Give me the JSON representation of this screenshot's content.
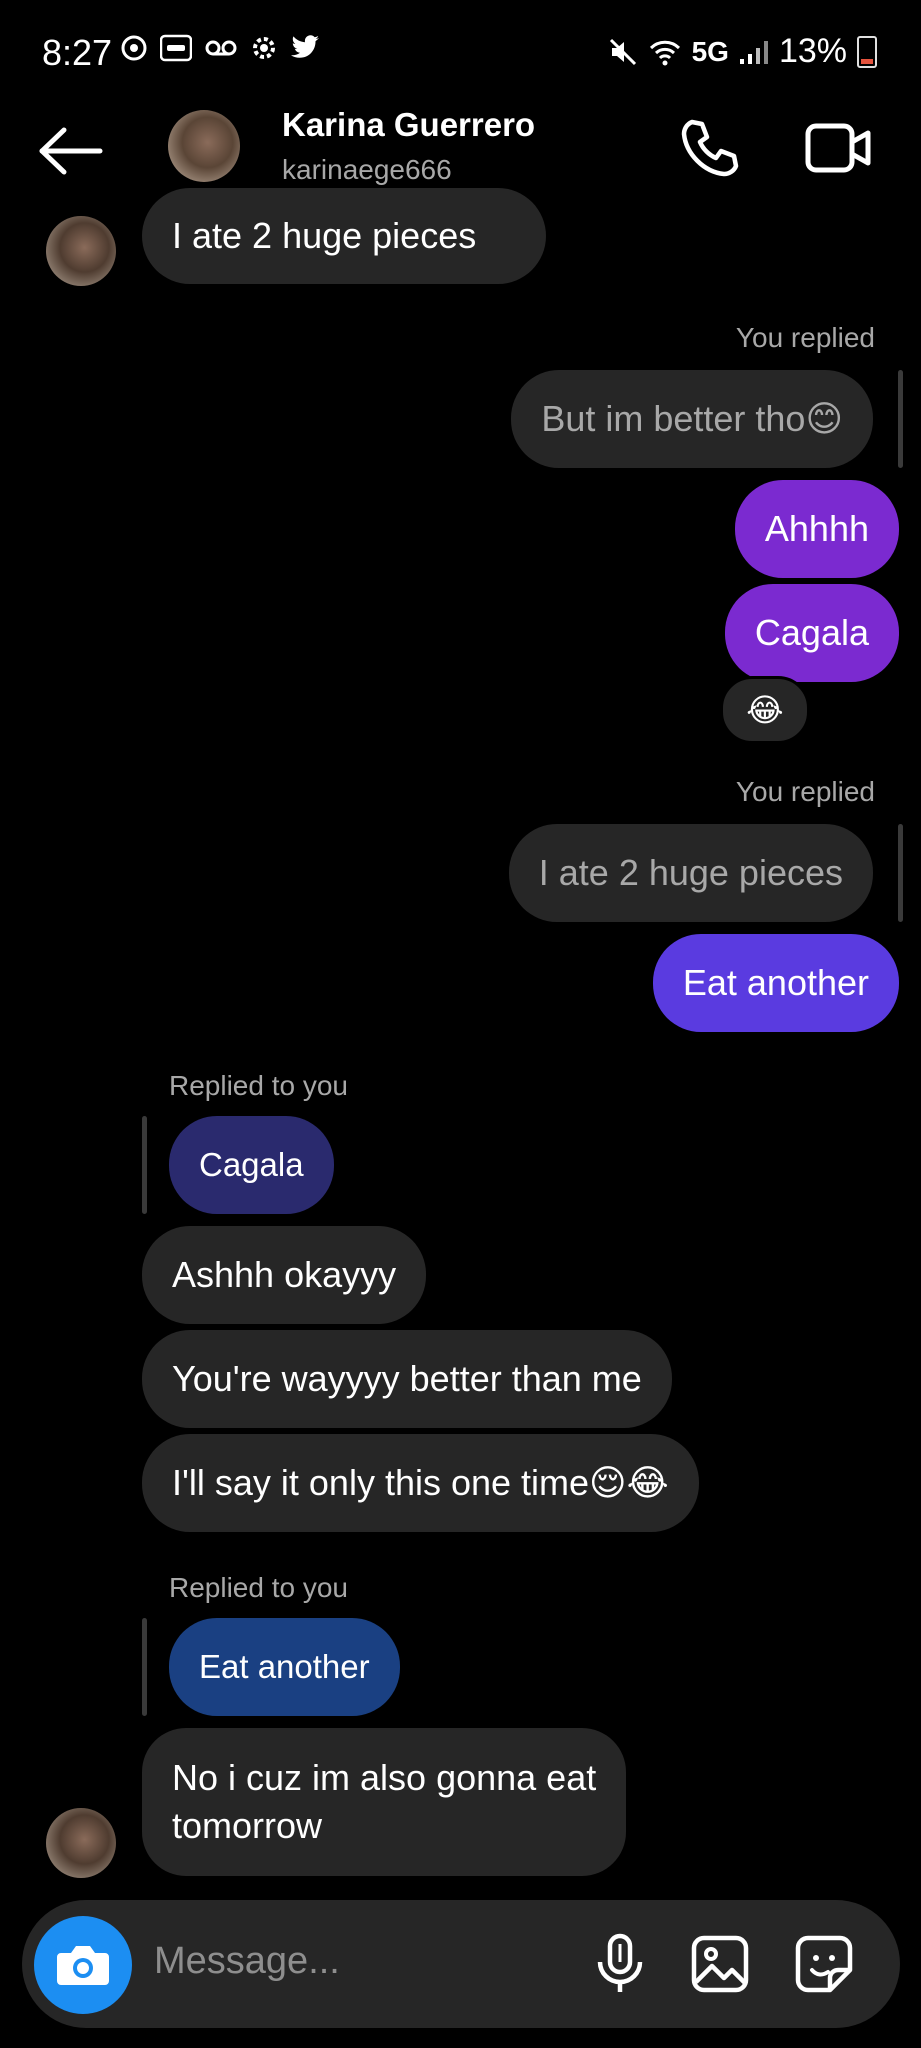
{
  "status_bar": {
    "time": "8:27",
    "network": "5G",
    "battery": "13%"
  },
  "header": {
    "name": "Karina Guerrero",
    "username": "karinaege666"
  },
  "messages": {
    "m1": "I ate 2 huge pieces",
    "r1_label": "You replied",
    "r1_quote": "But im better tho😊",
    "m2": "Ahhhh",
    "m3": "Cagala",
    "m3_reaction": "😂",
    "r2_label": "You replied",
    "r2_quote": "I ate 2 huge pieces",
    "m4": "Eat another",
    "r3_label": "Replied to you",
    "r3_quote": "Cagala",
    "m5": "Ashhh okayyy",
    "m6": "You're wayyyy better than me",
    "m7": "I'll say it only this one time😌😂",
    "r4_label": "Replied to you",
    "r4_quote": "Eat another",
    "m8_line1": "No i cuz im also gonna eat",
    "m8_line2": "tomorrow"
  },
  "composer": {
    "placeholder": "Message..."
  },
  "colors": {
    "background": "#000000",
    "incoming_bubble": "#262626",
    "outgoing_purple": "#7b2ad0",
    "outgoing_violet": "#5a3be0",
    "camera_button": "#1c8ef2"
  }
}
